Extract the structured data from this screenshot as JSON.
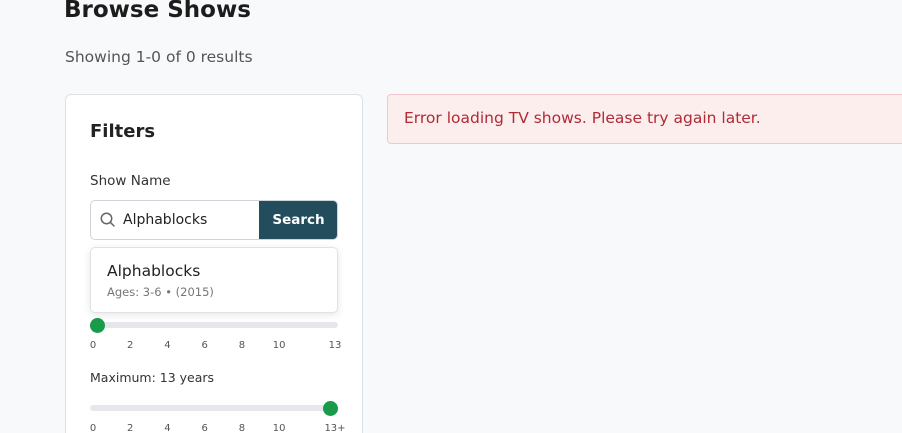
{
  "header": {
    "title": "Browse Shows",
    "result_summary": "Showing 1-0 of 0 results"
  },
  "filters": {
    "title": "Filters",
    "show_name": {
      "label": "Show Name",
      "value": "Alphablocks",
      "search_label": "Search",
      "icon": "search-icon"
    },
    "min_age": {
      "value": 0,
      "ticks": [
        "0",
        "2",
        "4",
        "6",
        "8",
        "10",
        "13"
      ]
    },
    "max_age": {
      "label": "Maximum: 13 years",
      "value": 13,
      "ticks": [
        "0",
        "2",
        "4",
        "6",
        "8",
        "10",
        "13+"
      ]
    }
  },
  "suggestions": [
    {
      "title": "Alphablocks",
      "meta": "Ages: 3-6 • (2015)"
    }
  ],
  "error": {
    "message": "Error loading TV shows. Please try again later."
  },
  "colors": {
    "accent_button": "#234d5c",
    "slider_thumb": "#1a9b4b",
    "error_text": "#b02a37",
    "error_bg": "#fdeeee"
  }
}
